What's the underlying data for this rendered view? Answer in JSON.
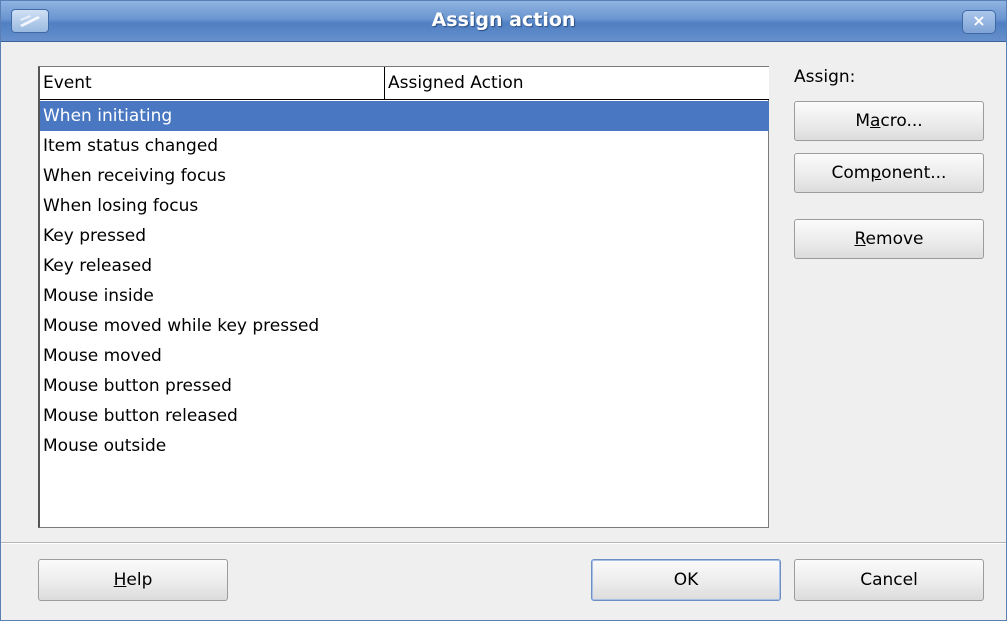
{
  "window": {
    "title": "Assign action",
    "close_symbol": "×",
    "app_icon": "app-icon"
  },
  "list": {
    "columns": [
      "Event",
      "Assigned Action"
    ],
    "selected_index": 0,
    "rows": [
      {
        "event": "When initiating",
        "action": ""
      },
      {
        "event": "Item status changed",
        "action": ""
      },
      {
        "event": "When receiving focus",
        "action": ""
      },
      {
        "event": "When losing focus",
        "action": ""
      },
      {
        "event": "Key pressed",
        "action": ""
      },
      {
        "event": "Key released",
        "action": ""
      },
      {
        "event": "Mouse inside",
        "action": ""
      },
      {
        "event": "Mouse moved while key pressed",
        "action": ""
      },
      {
        "event": "Mouse moved",
        "action": ""
      },
      {
        "event": "Mouse button pressed",
        "action": ""
      },
      {
        "event": "Mouse button released",
        "action": ""
      },
      {
        "event": "Mouse outside",
        "action": ""
      }
    ]
  },
  "assign": {
    "label": "Assign:",
    "macro": {
      "pre": "M",
      "mnemonic": "a",
      "post": "cro..."
    },
    "component": {
      "pre": "Com",
      "mnemonic": "p",
      "post": "onent..."
    },
    "remove": {
      "pre": "",
      "mnemonic": "R",
      "post": "emove"
    }
  },
  "footer": {
    "help": {
      "pre": "",
      "mnemonic": "H",
      "post": "elp"
    },
    "ok": "OK",
    "cancel": "Cancel"
  },
  "colors": {
    "selection": "#4a77c2",
    "titlebar": "#6a95d0"
  }
}
